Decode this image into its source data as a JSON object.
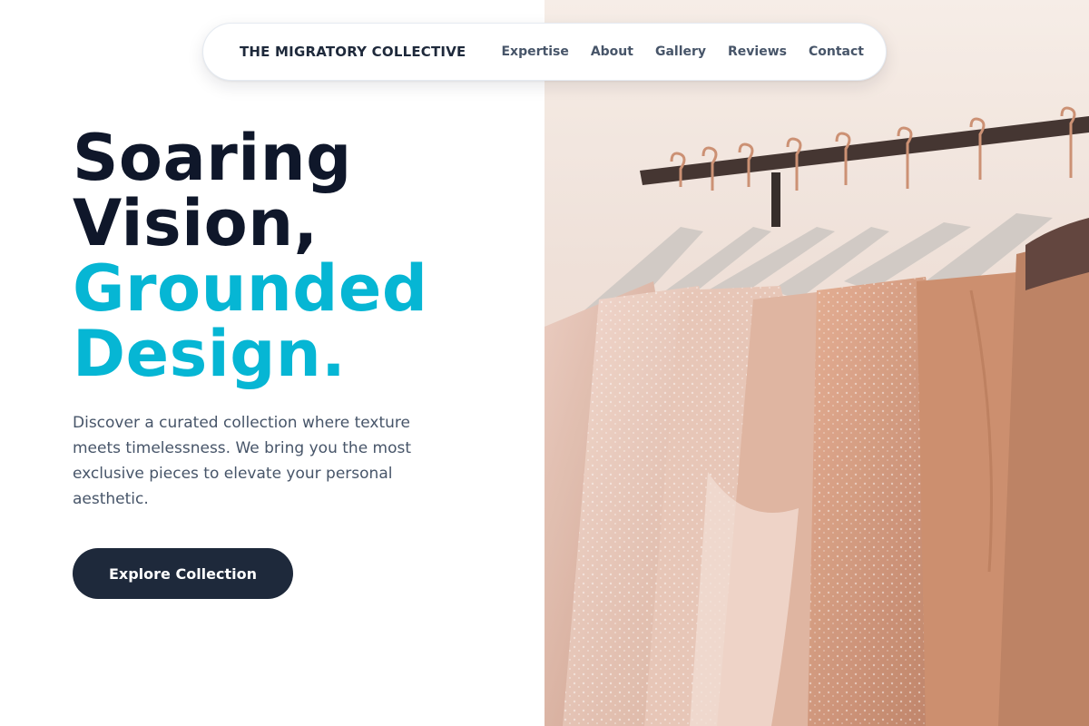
{
  "nav": {
    "brand": "THE MIGRATORY COLLECTIVE",
    "links": [
      "Expertise",
      "About",
      "Gallery",
      "Reviews",
      "Contact"
    ]
  },
  "hero": {
    "headline_dark": [
      "Soaring",
      "Vision,"
    ],
    "headline_accent": [
      "Grounded",
      "Design."
    ],
    "lead": "Discover a curated collection where texture meets timelessness. We bring you the most exclusive pieces to elevate your personal aesthetic.",
    "cta_label": "Explore Collection",
    "image_alt": "Dresses on wooden hangers"
  },
  "colors": {
    "headline_dark": "#0f172a",
    "headline_accent": "#06b6d4",
    "button_bg": "#1e293b",
    "body_text": "#475569"
  }
}
